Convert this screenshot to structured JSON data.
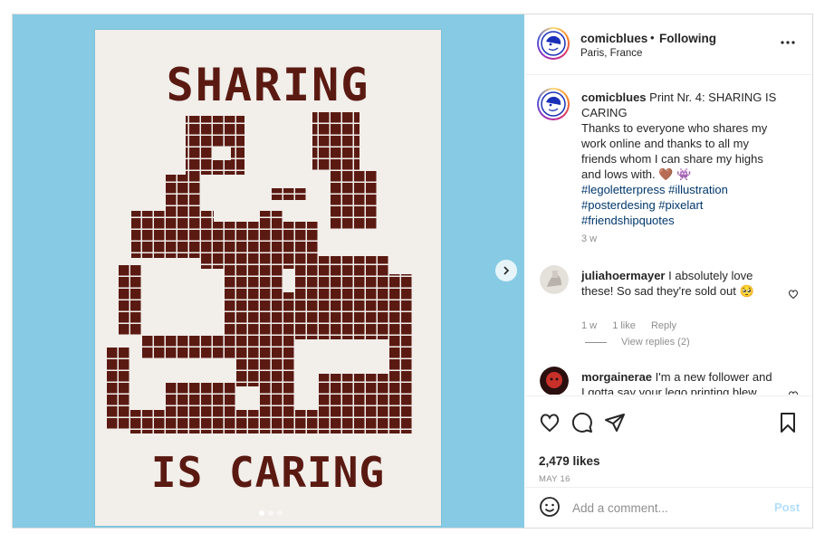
{
  "post": {
    "media": {
      "poster_text_top": "SHARING",
      "poster_text_bottom": "IS CARING",
      "carousel": {
        "count": 3,
        "active": 0
      }
    },
    "header": {
      "username": "comicblues",
      "separator": "•",
      "follow_status": "Following",
      "location": "Paris, France"
    },
    "caption": {
      "username": "comicblues",
      "text": "Print Nr. 4: SHARING IS CARING",
      "body": "Thanks to everyone who shares my work online and thanks to all my friends whom I can share my highs and lows with. 🤎 👾",
      "hashtags": "#legoletterpress #illustration #posterdesing #pixelart #friendshipquotes",
      "time": "3 w"
    },
    "comments": [
      {
        "username": "juliahoermayer",
        "text": "I absolutely love these! So sad they're sold out 🥺",
        "time": "1 w",
        "likes": "1 like",
        "reply": "Reply",
        "view_replies": "View replies (2)"
      },
      {
        "username": "morgainerae",
        "text": "I'm a new follower and I gotta say your lego printing blew"
      }
    ],
    "actions": {
      "likes": "2,479 likes",
      "date": "MAY 16"
    },
    "add_comment": {
      "placeholder": "Add a comment...",
      "post_label": "Post"
    },
    "colors": {
      "media_background": "#86cbe3",
      "poster_ink": "#5a1a12",
      "poster_paper": "#f2eeea",
      "hashtag": "#00376b",
      "post_button": "#b2dffc"
    },
    "icons": [
      "chevron-right-icon",
      "more-icon",
      "heart-icon",
      "comment-icon",
      "share-icon",
      "bookmark-icon",
      "emoji-icon"
    ]
  }
}
